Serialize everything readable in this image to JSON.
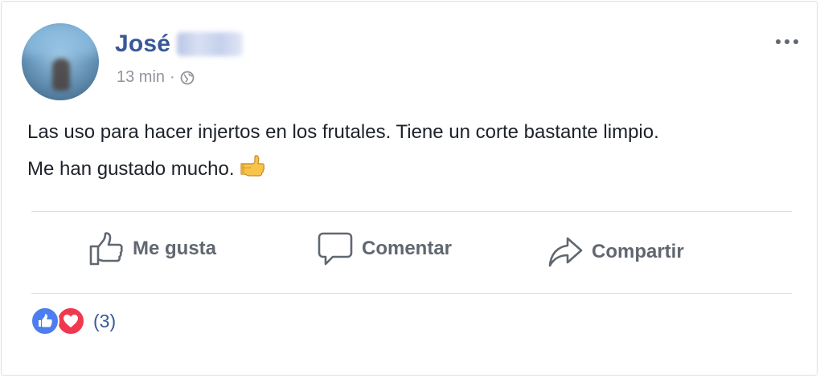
{
  "post": {
    "author": {
      "name": "José",
      "surname_redacted": true
    },
    "time": "13 min",
    "separator": "·",
    "privacy_icon": "globe-icon",
    "menu_icon": "more-options-icon",
    "text_line1": "Las uso para hacer injertos en los frutales. Tiene un corte bastante limpio.",
    "text_line2": "Me han gustado mucho.",
    "emoji": "thumbs-up-emoji"
  },
  "actions": {
    "like_label": "Me gusta",
    "comment_label": "Comentar",
    "share_label": "Compartir"
  },
  "reactions": {
    "types": [
      "like",
      "love"
    ],
    "count": "(3)"
  },
  "colors": {
    "name": "#385898",
    "meta": "#90949c",
    "text": "#1d2129",
    "action": "#606770",
    "like": "#4d7ef0",
    "love": "#f0384f"
  }
}
